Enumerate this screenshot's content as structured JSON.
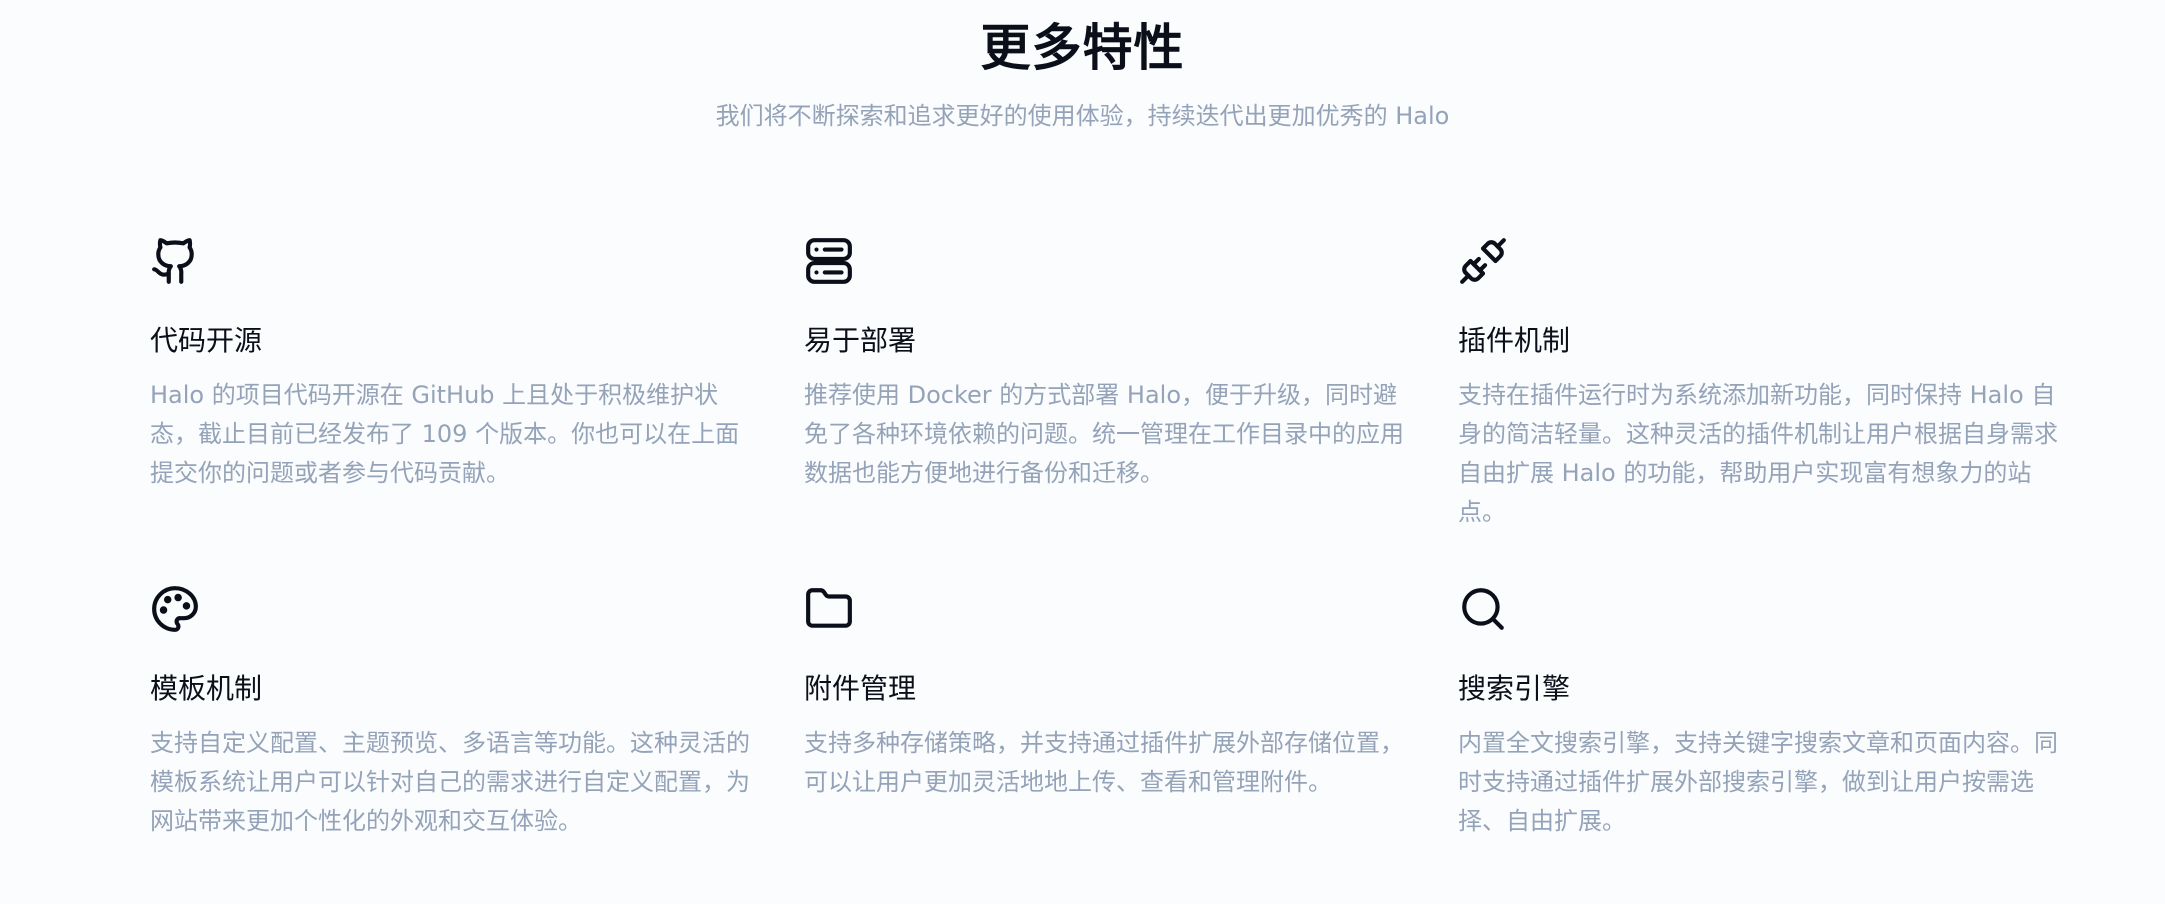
{
  "section": {
    "title": "更多特性",
    "subtitle": "我们将不断探索和追求更好的使用体验，持续迭代出更加优秀的 Halo"
  },
  "features": [
    {
      "icon": "github-icon",
      "title": "代码开源",
      "description": "Halo 的项目代码开源在 GitHub 上且处于积极维护状态，截止目前已经发布了 109 个版本。你也可以在上面提交你的问题或者参与代码贡献。"
    },
    {
      "icon": "server-icon",
      "title": "易于部署",
      "description": "推荐使用 Docker 的方式部署 Halo，便于升级，同时避免了各种环境依赖的问题。统一管理在工作目录中的应用数据也能方便地进行备份和迁移。"
    },
    {
      "icon": "plug-icon",
      "title": "插件机制",
      "description": "支持在插件运行时为系统添加新功能，同时保持 Halo 自身的简洁轻量。这种灵活的插件机制让用户根据自身需求自由扩展 Halo 的功能，帮助用户实现富有想象力的站点。"
    },
    {
      "icon": "palette-icon",
      "title": "模板机制",
      "description": "支持自定义配置、主题预览、多语言等功能。这种灵活的模板系统让用户可以针对自己的需求进行自定义配置，为网站带来更加个性化的外观和交互体验。"
    },
    {
      "icon": "folder-icon",
      "title": "附件管理",
      "description": "支持多种存储策略，并支持通过插件扩展外部存储位置，可以让用户更加灵活地地上传、查看和管理附件。"
    },
    {
      "icon": "search-icon",
      "title": "搜索引擎",
      "description": "内置全文搜索引擎，支持关键字搜索文章和页面内容。同时支持通过插件扩展外部搜索引擎，做到让用户按需选择、自由扩展。"
    }
  ]
}
